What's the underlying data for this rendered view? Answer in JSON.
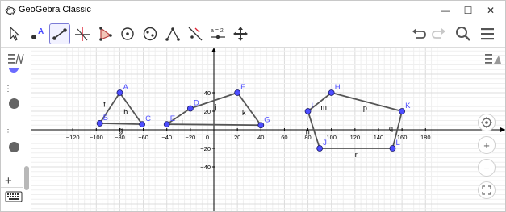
{
  "window": {
    "title": "GeoGebra Classic",
    "minimize_glyph": "—",
    "maximize_glyph": "☐",
    "close_glyph": "✕"
  },
  "toolbar": {
    "tools": [
      {
        "name": "move-tool",
        "icon": "arrow-cursor-icon"
      },
      {
        "name": "point-tool",
        "icon": "point-a-icon"
      },
      {
        "name": "segment-tool",
        "icon": "segment-icon"
      },
      {
        "name": "perpendicular-tool",
        "icon": "perpendicular-line-icon"
      },
      {
        "name": "polygon-tool",
        "icon": "polygon-icon"
      },
      {
        "name": "circle-tool",
        "icon": "circle-center-point-icon"
      },
      {
        "name": "ellipse-tool",
        "icon": "ellipse-icon"
      },
      {
        "name": "angle-tool",
        "icon": "angle-icon"
      },
      {
        "name": "reflect-tool",
        "icon": "reflect-line-icon"
      },
      {
        "name": "slider-tool",
        "icon": "slider-icon"
      },
      {
        "name": "move-graphics-tool",
        "icon": "move-graphics-icon"
      }
    ],
    "slider_label": "a = 2",
    "undo_icon": "undo-icon",
    "redo_icon": "redo-icon",
    "search_icon": "search-icon",
    "menu_icon": "hamburger-menu-icon"
  },
  "colors": {
    "segment": "#555555",
    "point_fill": "#4d4dff",
    "label": "#4d4dff",
    "grid": "#e6e6e6",
    "axis": "#000000",
    "active_tool": "#7b7bd6"
  },
  "graphics": {
    "x_ticks": [
      "−120",
      "−100",
      "−80",
      "−60",
      "−40",
      "−20",
      "0",
      "20",
      "40",
      "60",
      "80",
      "100",
      "120",
      "140",
      "160",
      "180"
    ],
    "y_ticks": [
      "40",
      "20",
      "−20",
      "−40"
    ],
    "points": [
      {
        "label": "A",
        "x": -80,
        "y": 40
      },
      {
        "label": "B",
        "x": -97,
        "y": 7
      },
      {
        "label": "C",
        "x": -61,
        "y": 6
      },
      {
        "label": "D",
        "x": -20,
        "y": 23
      },
      {
        "label": "E",
        "x": -40,
        "y": 6
      },
      {
        "label": "F",
        "x": 20,
        "y": 40
      },
      {
        "label": "G",
        "x": 40,
        "y": 5
      },
      {
        "label": "H",
        "x": 100,
        "y": 40
      },
      {
        "label": "I",
        "x": 80,
        "y": 20
      },
      {
        "label": "J",
        "x": 90,
        "y": -20
      },
      {
        "label": "K",
        "x": 160,
        "y": 20
      },
      {
        "label": "L",
        "x": 152,
        "y": -20
      }
    ],
    "segments": [
      {
        "label": "f",
        "from": "A",
        "to": "B"
      },
      {
        "label": "h",
        "from": "A",
        "to": "C"
      },
      {
        "label": "g",
        "from": "B",
        "to": "C"
      },
      {
        "label": "i",
        "from": "E",
        "to": "D"
      },
      {
        "label": "j",
        "from": "D",
        "to": "F"
      },
      {
        "label": "k",
        "from": "F",
        "to": "G"
      },
      {
        "label": "l",
        "from": "E",
        "to": "G"
      },
      {
        "label": "m",
        "from": "I",
        "to": "H"
      },
      {
        "label": "p",
        "from": "H",
        "to": "K"
      },
      {
        "label": "q",
        "from": "K",
        "to": "L"
      },
      {
        "label": "r",
        "from": "J",
        "to": "L"
      },
      {
        "label": "n",
        "from": "I",
        "to": "J"
      }
    ]
  },
  "side_controls": {
    "home_icon": "target-home-icon",
    "zoom_in": "+",
    "zoom_out": "−",
    "fullscreen_icon": "fullscreen-icon",
    "style_bar_icon": "graphics-style-bar-icon",
    "algebra_style_icon": "algebra-style-bar-icon",
    "add_glyph": "+",
    "keyboard_icon": "keyboard-icon"
  }
}
